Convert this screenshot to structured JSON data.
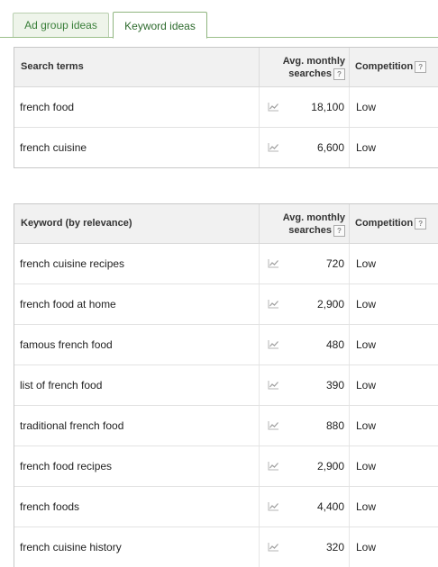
{
  "tabs": [
    {
      "label": "Ad group ideas",
      "active": false
    },
    {
      "label": "Keyword ideas",
      "active": true
    }
  ],
  "search_terms": {
    "header": {
      "term": "Search terms",
      "avg_line1": "Avg. monthly",
      "avg_line2": "searches",
      "competition": "Competition",
      "help": "?"
    },
    "rows": [
      {
        "term": "french food",
        "volume": "18,100",
        "competition": "Low"
      },
      {
        "term": "french cuisine",
        "volume": "6,600",
        "competition": "Low"
      }
    ]
  },
  "keywords": {
    "header": {
      "term": "Keyword (by relevance)",
      "avg_line1": "Avg. monthly",
      "avg_line2": "searches",
      "competition": "Competition",
      "help": "?"
    },
    "rows": [
      {
        "term": "french cuisine recipes",
        "volume": "720",
        "competition": "Low"
      },
      {
        "term": "french food at home",
        "volume": "2,900",
        "competition": "Low"
      },
      {
        "term": "famous french food",
        "volume": "480",
        "competition": "Low"
      },
      {
        "term": "list of french food",
        "volume": "390",
        "competition": "Low"
      },
      {
        "term": "traditional french food",
        "volume": "880",
        "competition": "Low"
      },
      {
        "term": "french food recipes",
        "volume": "2,900",
        "competition": "Low"
      },
      {
        "term": "french foods",
        "volume": "4,400",
        "competition": "Low"
      },
      {
        "term": "french cuisine history",
        "volume": "320",
        "competition": "Low"
      }
    ]
  },
  "colors": {
    "tab_text": "#3a7f3a",
    "header_bg": "#f1f1f1",
    "border": "#c8c8c8"
  },
  "icons": {
    "trend": "trend-chart-icon",
    "help": "help-icon"
  }
}
